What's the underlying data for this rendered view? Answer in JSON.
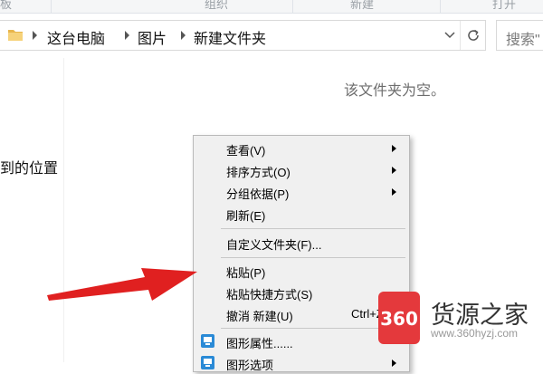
{
  "ribbon": {
    "groups": [
      "板",
      "组织",
      "新建",
      "打开"
    ]
  },
  "address_bar": {
    "breadcrumbs": [
      "这台电脑",
      "图片",
      "新建文件夹"
    ],
    "search_placeholder": "搜索\""
  },
  "content": {
    "empty_message": "该文件夹为空。",
    "left_text": "到的位置"
  },
  "context_menu": {
    "items": [
      {
        "label": "查看(V)",
        "submenu": true
      },
      {
        "label": "排序方式(O)",
        "submenu": true
      },
      {
        "label": "分组依据(P)",
        "submenu": true
      },
      {
        "label": "刷新(E)",
        "submenu": false
      },
      {
        "label": "自定义文件夹(F)...",
        "submenu": false
      },
      {
        "label": "粘贴(P)",
        "submenu": false
      },
      {
        "label": "粘贴快捷方式(S)",
        "submenu": false
      },
      {
        "label": "撤消 新建(U)",
        "shortcut": "Ctrl+Z",
        "submenu": false
      },
      {
        "label": "图形属性......",
        "icon": "intel-graphics-icon",
        "submenu": false
      },
      {
        "label": "图形选项",
        "icon": "intel-graphics-icon",
        "submenu": true
      }
    ]
  },
  "watermark": {
    "badge": "360",
    "name": "货源之家",
    "url": "www.360hyzj.com"
  },
  "colors": {
    "annotation_arrow": "#e02020",
    "menu_bg": "#f0f0f0",
    "intel_icon": "#2a8ad6",
    "watermark_red": "#e4393c"
  }
}
